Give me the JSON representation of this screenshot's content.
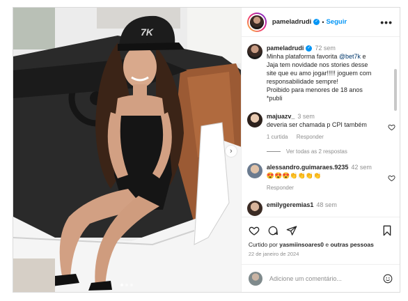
{
  "post": {
    "author": "pameladrudi",
    "verified": true,
    "follow_label": "Seguir",
    "separator": "•",
    "more_label": "•••",
    "photo_dots": 3,
    "photo_active_dot": 1,
    "next_icon": "chevron-right-icon"
  },
  "caption": {
    "user": "pameladrudi",
    "time": "72 sem",
    "text_before": "Minha plataforma favorita ",
    "mention": "@bet7k",
    "text_after": " e Jaja tem novidade nos stories desse site que eu amo jogar!!!!! joguem com responsabilidade sempre!",
    "line2": "Proibido para menores de 18 anos",
    "line3": "*publi"
  },
  "comments": [
    {
      "user": "majuazv_",
      "time": "3 sem",
      "text": "deveria ser chamada p CPI também",
      "likes": "1 curtida",
      "reply": "Responder",
      "view_replies": "Ver todas as 2 respostas"
    },
    {
      "user": "alessandro.guimaraes.9235",
      "time": "42 sem",
      "text": "😍😍😍👏👏👏👏",
      "reply": "Responder"
    },
    {
      "user": "emilygeremias1",
      "time": "48 sem"
    }
  ],
  "actions": {
    "liked_by_prefix": "Curtido por ",
    "liked_by_user": "yasmiinsoares0",
    "liked_by_suffix": " e ",
    "others": "outras pessoas",
    "date": "22 de janeiro de 2024"
  },
  "add_comment": {
    "placeholder": "Adicione um comentário..."
  },
  "colors": {
    "accent": "#0095f6",
    "muted": "#8e8e8e",
    "text": "#262626"
  }
}
